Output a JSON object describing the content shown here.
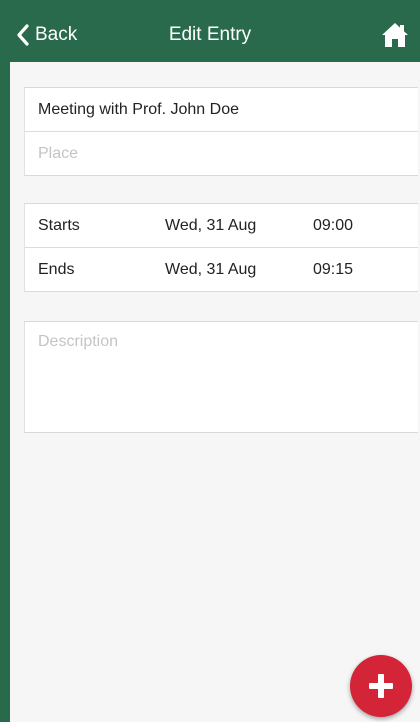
{
  "navbar": {
    "back_label": "Back",
    "title": "Edit Entry",
    "back_icon": "chevron-left-icon",
    "home_icon": "home-icon"
  },
  "entry": {
    "title_value": "Meeting with Prof. John Doe",
    "place_placeholder": "Place"
  },
  "schedule": {
    "starts": {
      "label": "Starts",
      "date": "Wed, 31 Aug",
      "time": "09:00"
    },
    "ends": {
      "label": "Ends",
      "date": "Wed, 31 Aug",
      "time": "09:15"
    }
  },
  "description": {
    "placeholder": "Description"
  },
  "fab": {
    "icon": "plus-icon"
  },
  "colors": {
    "navbar_green": "#2a6a4c",
    "fab_red": "#d32438",
    "background": "#f6f6f6"
  }
}
